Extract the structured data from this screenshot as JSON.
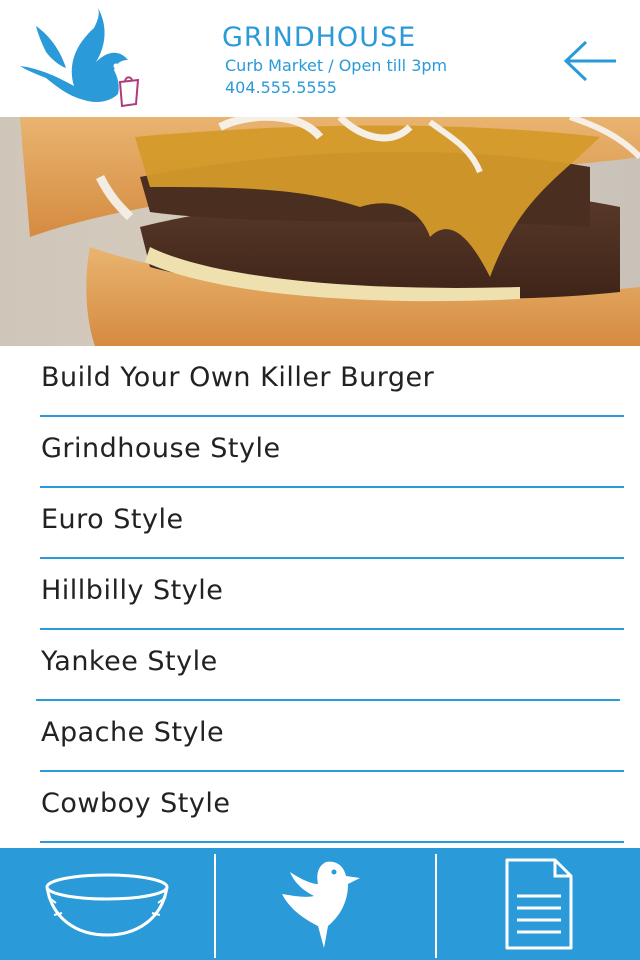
{
  "header": {
    "title": "GRINDHOUSE",
    "subtitle": "Curb Market / Open till 3pm",
    "phone": "404.555.5555",
    "logo_icon": "swallow-bird-logo-icon",
    "back_icon": "arrow-left-icon"
  },
  "hero": {
    "image": "burger-photo"
  },
  "menu": {
    "items": [
      {
        "label": "Build Your Own Killer Burger"
      },
      {
        "label": "Grindhouse Style"
      },
      {
        "label": "Euro Style"
      },
      {
        "label": "Hillbilly Style"
      },
      {
        "label": "Yankee Style"
      },
      {
        "label": "Apache Style"
      },
      {
        "label": "Cowboy Style"
      }
    ]
  },
  "tabbar": {
    "tabs": [
      {
        "icon": "bowl-icon"
      },
      {
        "icon": "bird-icon"
      },
      {
        "icon": "document-icon"
      }
    ]
  },
  "colors": {
    "accent": "#2a9ad8",
    "background": "#ffffff",
    "text": "#222222"
  }
}
